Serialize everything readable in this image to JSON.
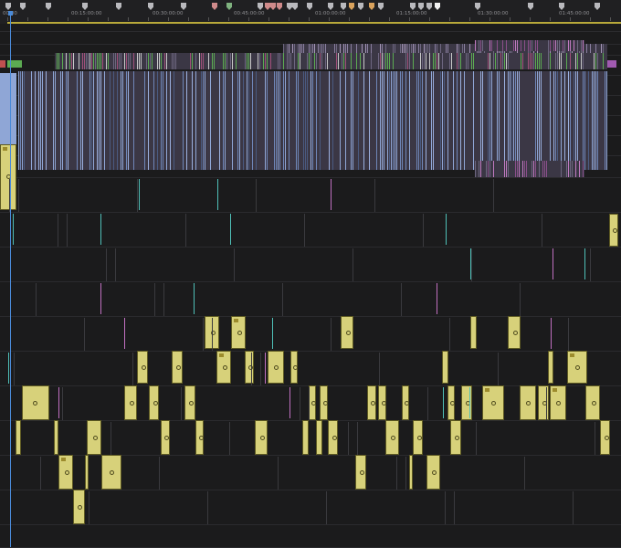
{
  "timeline": {
    "start_timecode": "00:00",
    "timecodes": [
      "00:15:00:00",
      "00:30:00:00",
      "00:45:00:00",
      "01:00:00:00",
      "01:15:00:00",
      "01:30:00:00",
      "01:45:00:00"
    ],
    "marker_colors": {
      "default": "#b9b9bd",
      "red": "#cf8a8a",
      "orange": "#d9a25c",
      "green": "#7fb27f",
      "white": "#f2f2f2"
    },
    "clip_color": "#d7d17a",
    "video_color": "#8fa6d6",
    "track_count": 15
  }
}
